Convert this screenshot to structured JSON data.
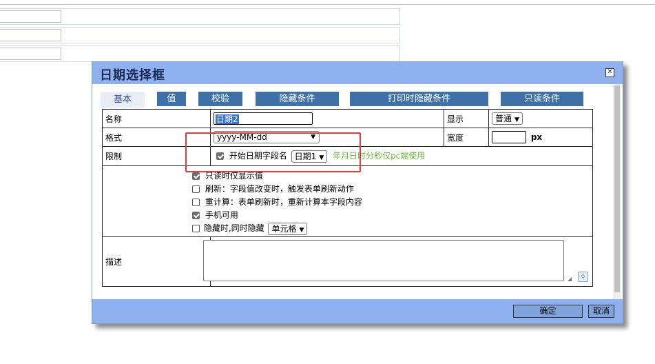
{
  "dialog": {
    "title": "日期选择框",
    "close_icon": "close-icon"
  },
  "tabs": [
    {
      "label": "基本",
      "active": true
    },
    {
      "label": "值",
      "active": false
    },
    {
      "label": "校验",
      "active": false
    },
    {
      "label": "隐藏条件",
      "active": false
    },
    {
      "label": "打印时隐藏条件",
      "active": false
    },
    {
      "label": "只读条件",
      "active": false
    }
  ],
  "form": {
    "name_label": "名称",
    "name_value": "日期2",
    "display_label": "显示",
    "display_value": "普通",
    "format_label": "格式",
    "format_value": "yyyy-MM-dd",
    "width_label": "宽度",
    "width_value": "",
    "width_unit": "px",
    "limit_label": "限制",
    "start_field_label": "开始日期字段名",
    "start_field_value": "日期1",
    "start_field_checked": true,
    "limit_hint": "年月日时分秒仅pc端使用",
    "options": [
      {
        "label": "只读时仅显示值",
        "checked": true
      },
      {
        "label": "刷新：字段值改变时，触发表单刷新动作",
        "checked": false
      },
      {
        "label": "重计算：表单刷新时，重新计算本字段内容",
        "checked": false
      },
      {
        "label": "手机可用",
        "checked": true
      }
    ],
    "hide_label": "隐藏时,同时隐藏",
    "hide_checked": false,
    "hide_value": "单元格",
    "desc_label": "描述",
    "desc_value": ""
  },
  "footer": {
    "ok_label": "确定",
    "cancel_label": "取消"
  },
  "colors": {
    "header_bg": "#8fb0ef",
    "tab_inactive": "#3e71a8",
    "highlight_border": "#e23b3b",
    "hint_text": "#6cba3b"
  }
}
